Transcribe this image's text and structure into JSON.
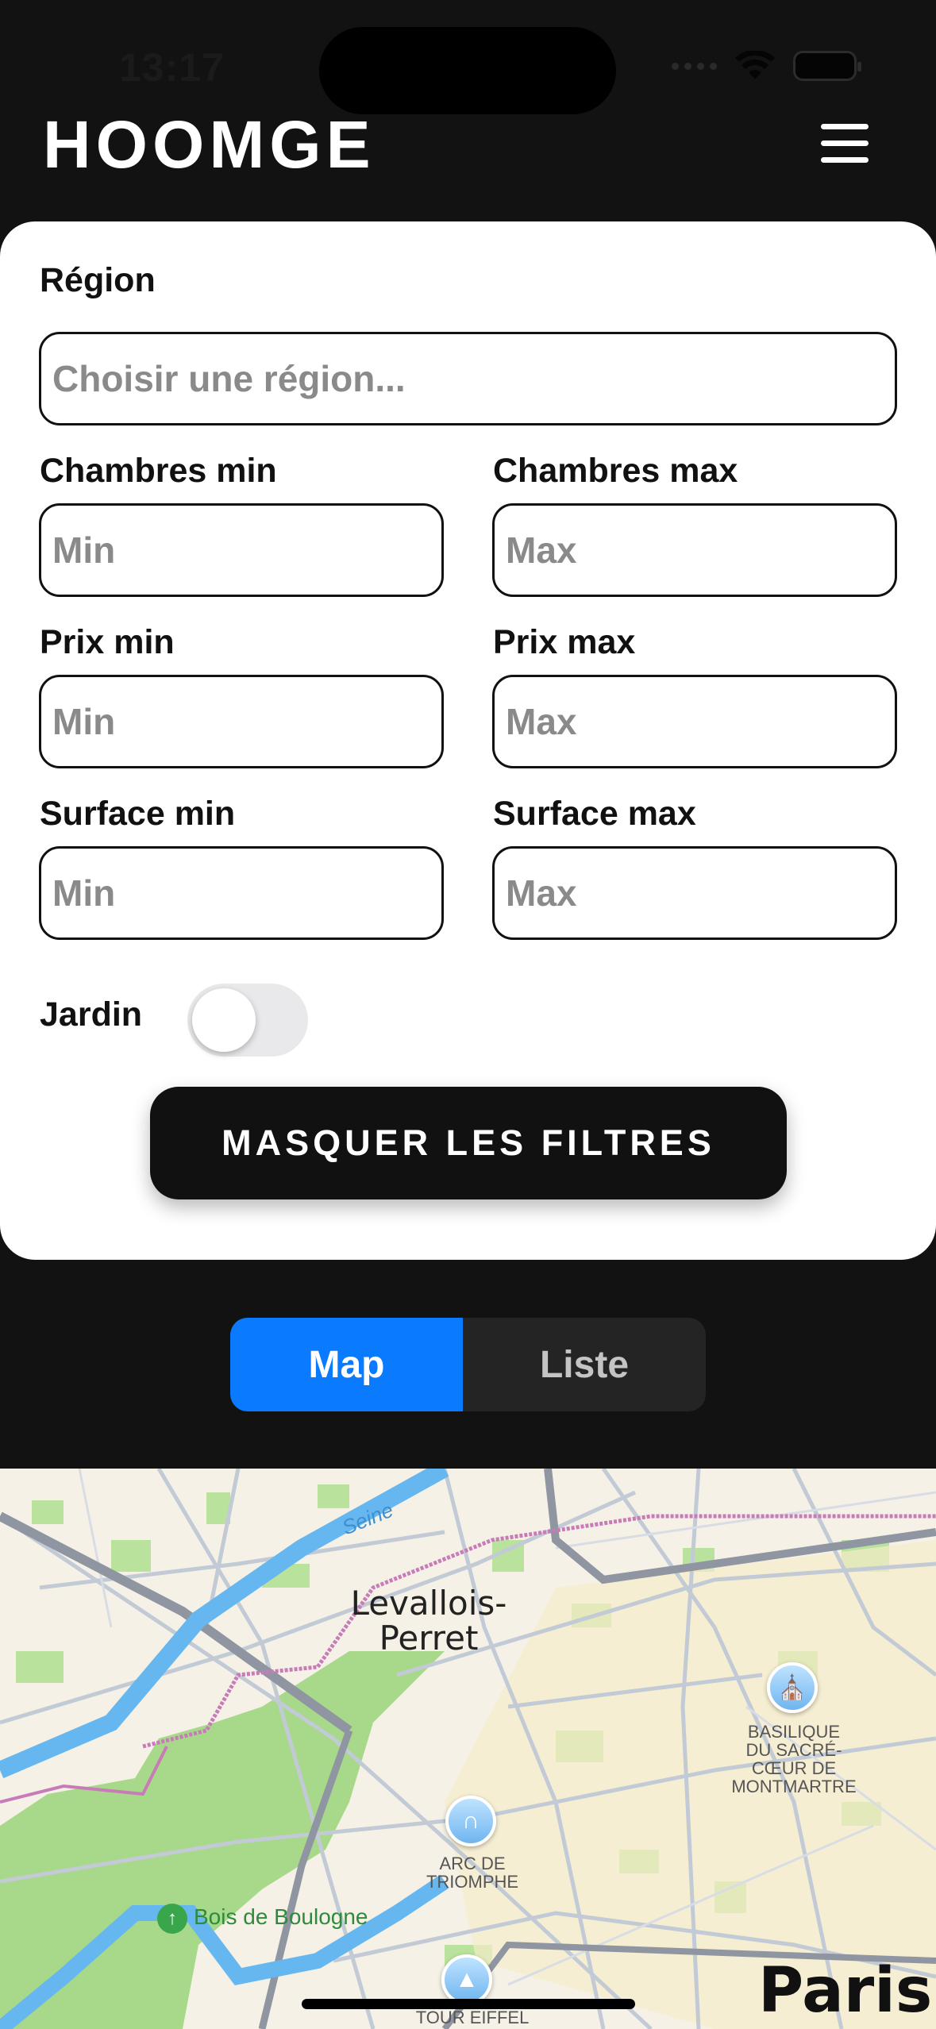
{
  "status_bar": {
    "time": "13:17"
  },
  "header": {
    "title": "HOOMGE",
    "menu_icon": "hamburger-menu-icon"
  },
  "filters": {
    "region": {
      "label": "Région",
      "placeholder": "Choisir une région..."
    },
    "rooms_min": {
      "label": "Chambres min",
      "placeholder": "Min"
    },
    "rooms_max": {
      "label": "Chambres max",
      "placeholder": "Max"
    },
    "price_min": {
      "label": "Prix min",
      "placeholder": "Min"
    },
    "price_max": {
      "label": "Prix max",
      "placeholder": "Max"
    },
    "surface_min": {
      "label": "Surface min",
      "placeholder": "Min"
    },
    "surface_max": {
      "label": "Surface max",
      "placeholder": "Max"
    },
    "garden": {
      "label": "Jardin",
      "enabled": false
    },
    "hide_button": "MASQUER LES FILTRES"
  },
  "view_toggle": {
    "options": [
      "Map",
      "Liste"
    ],
    "selected": "Map",
    "accent": "#0a7aff"
  },
  "map": {
    "labels": {
      "seine": "Seine",
      "levallois": "Levallois-\nPerret",
      "bois": "Bois de Boulogne",
      "arc": "ARC DE\nTRIOMPHE",
      "sacre_coeur": "BASILIQUE\nDU SACRÉ-\nCŒUR DE\nMONTMARTRE",
      "eiffel": "TOUR EIFFEL",
      "paris": "Paris"
    }
  }
}
